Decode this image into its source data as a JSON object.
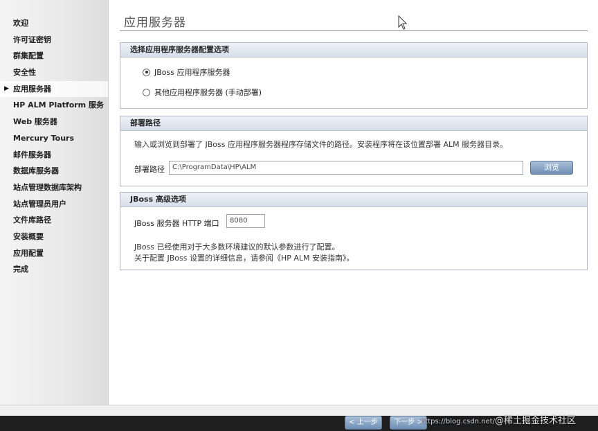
{
  "sidebar": {
    "items": [
      {
        "label": "欢迎",
        "active": false
      },
      {
        "label": "许可证密钥",
        "active": false
      },
      {
        "label": "群集配置",
        "active": false
      },
      {
        "label": "安全性",
        "active": false
      },
      {
        "label": "应用服务器",
        "active": true
      },
      {
        "label": "HP ALM Platform 服务",
        "active": false
      },
      {
        "label": "Web 服务器",
        "active": false
      },
      {
        "label": "Mercury Tours",
        "active": false
      },
      {
        "label": "邮件服务器",
        "active": false
      },
      {
        "label": "数据库服务器",
        "active": false
      },
      {
        "label": "站点管理数据库架构",
        "active": false
      },
      {
        "label": "站点管理员用户",
        "active": false
      },
      {
        "label": "文件库路径",
        "active": false
      },
      {
        "label": "安装概要",
        "active": false
      },
      {
        "label": "应用配置",
        "active": false
      },
      {
        "label": "完成",
        "active": false
      }
    ]
  },
  "main": {
    "title": "应用服务器",
    "app_server_panel": {
      "header": "选择应用程序服务器配置选项",
      "options": [
        {
          "label": "JBoss 应用程序服务器",
          "checked": true
        },
        {
          "label": "其他应用程序服务器 (手动部署)",
          "checked": false
        }
      ]
    },
    "deploy_panel": {
      "header": "部署路径",
      "description": "输入或浏览到部署了 JBoss 应用程序服务器程序存储文件的路径。安装程序将在该位置部署 ALM 服务器目录。",
      "path_label": "部署路径",
      "path_value": "C:\\ProgramData\\HP\\ALM",
      "browse_label": "浏览"
    },
    "jboss_panel": {
      "header": "JBoss 高级选项",
      "port_label": "JBoss 服务器 HTTP 端口",
      "port_value": "8080",
      "note_line1": "JBoss 已经使用对于大多数环境建议的默认参数进行了配置。",
      "note_line2": "关于配置 JBoss 设置的详细信息，请参阅《HP ALM 安装指南》。"
    }
  },
  "footer": {
    "back_label": "< 上一步",
    "next_label": "下一步 >"
  },
  "watermark": {
    "url": "https://blog.csdn.net/",
    "text": "@稀土掘金技术社区"
  },
  "colors": {
    "panel_header": "#d6dfea",
    "button": "#6f8fb4",
    "sidebar": "#e9e9e9"
  }
}
